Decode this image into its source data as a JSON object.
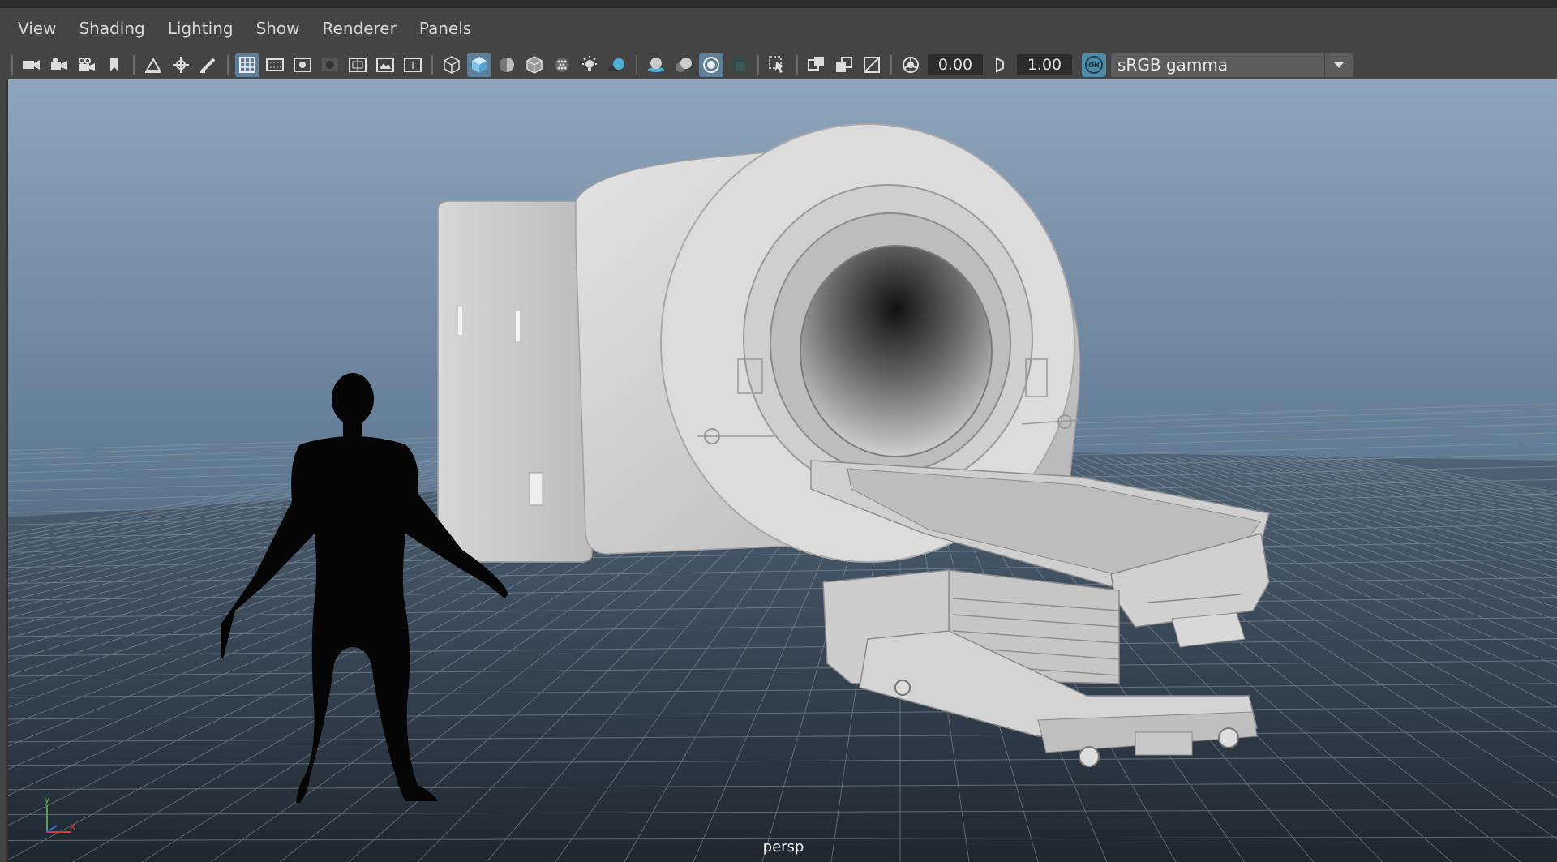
{
  "menubar": {
    "items": [
      "View",
      "Shading",
      "Lighting",
      "Show",
      "Renderer",
      "Panels"
    ]
  },
  "toolbar": {
    "exposure_value": "0.00",
    "gamma_value": "1.00",
    "color_management_toggle": "ON",
    "view_transform": "sRGB gamma",
    "icons": [
      "select-camera-icon",
      "camera-attributes-icon",
      "camera-lock-icon",
      "bookmark-icon",
      "image-plane-icon",
      "2d-pan-zoom-icon",
      "grease-pencil-icon",
      "grid-icon",
      "film-gate-icon",
      "resolution-gate-icon",
      "gate-mask-icon",
      "field-chart-icon",
      "safe-action-icon",
      "safe-title-icon",
      "wireframe-icon",
      "smooth-shade-icon",
      "wireframe-on-shaded-icon",
      "default-material-icon",
      "textured-icon",
      "use-all-lights-icon",
      "shadows-icon",
      "screen-space-ao-icon",
      "motion-blur-icon",
      "multisample-aa-icon",
      "depth-of-field-icon",
      "isolate-select-icon",
      "xray-icon",
      "xray-active-components-icon",
      "xray-joints-icon",
      "exposure-icon",
      "gamma-icon"
    ]
  },
  "viewport": {
    "camera": "persp",
    "axis_labels": {
      "y": "y",
      "x": "x"
    },
    "colors": {
      "sky_top": "#8aa0b8",
      "sky_bottom": "#3d4f5f",
      "grid_line": "#8e9aa6",
      "model_light": "#dadada",
      "model_mid": "#b5b5b5",
      "model_dark": "#8c8c8c",
      "silhouette": "#000000",
      "active_icon": "#5d7f97"
    },
    "scene_objects": [
      "mri-scanner",
      "patient-table",
      "human-silhouette",
      "ground-grid"
    ]
  }
}
